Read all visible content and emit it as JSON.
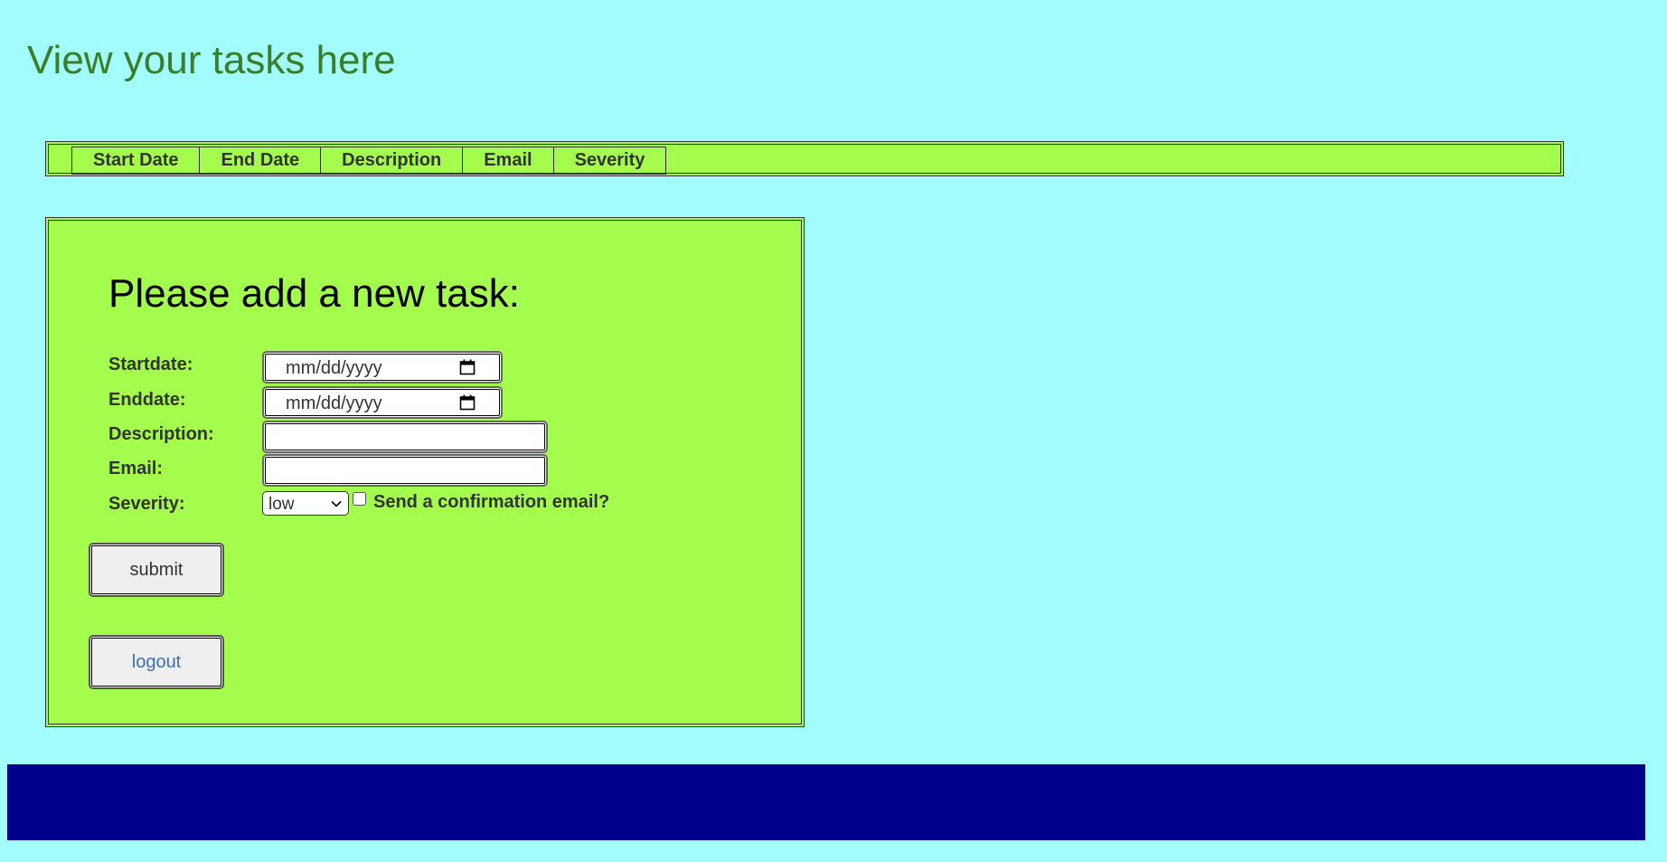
{
  "page": {
    "title": "View your tasks here"
  },
  "task_table": {
    "columns": [
      "Start Date",
      "End Date",
      "Description",
      "Email",
      "Severity"
    ]
  },
  "form": {
    "heading": "Please add a new task:",
    "startdate_label": "Startdate:",
    "enddate_label": "Enddate:",
    "description_label": "Description:",
    "email_label": "Email:",
    "severity_label": "Severity:",
    "date_placeholder": "mm/dd/yyyy",
    "description_value": "",
    "email_value": "",
    "severity_selected": "low",
    "confirm_checked": false,
    "confirm_label": "Send a confirmation email?",
    "submit_label": "submit",
    "logout_label": "logout"
  },
  "colors": {
    "page_background": "#a2fcfc",
    "panel_background": "#a4fc4c",
    "title_color": "#3a7d2a",
    "footer_color": "#00008b",
    "logout_link_color": "#3e6fb0"
  },
  "icons": {
    "date_picker": "calendar-icon",
    "select_arrow": "chevron-down-icon"
  }
}
